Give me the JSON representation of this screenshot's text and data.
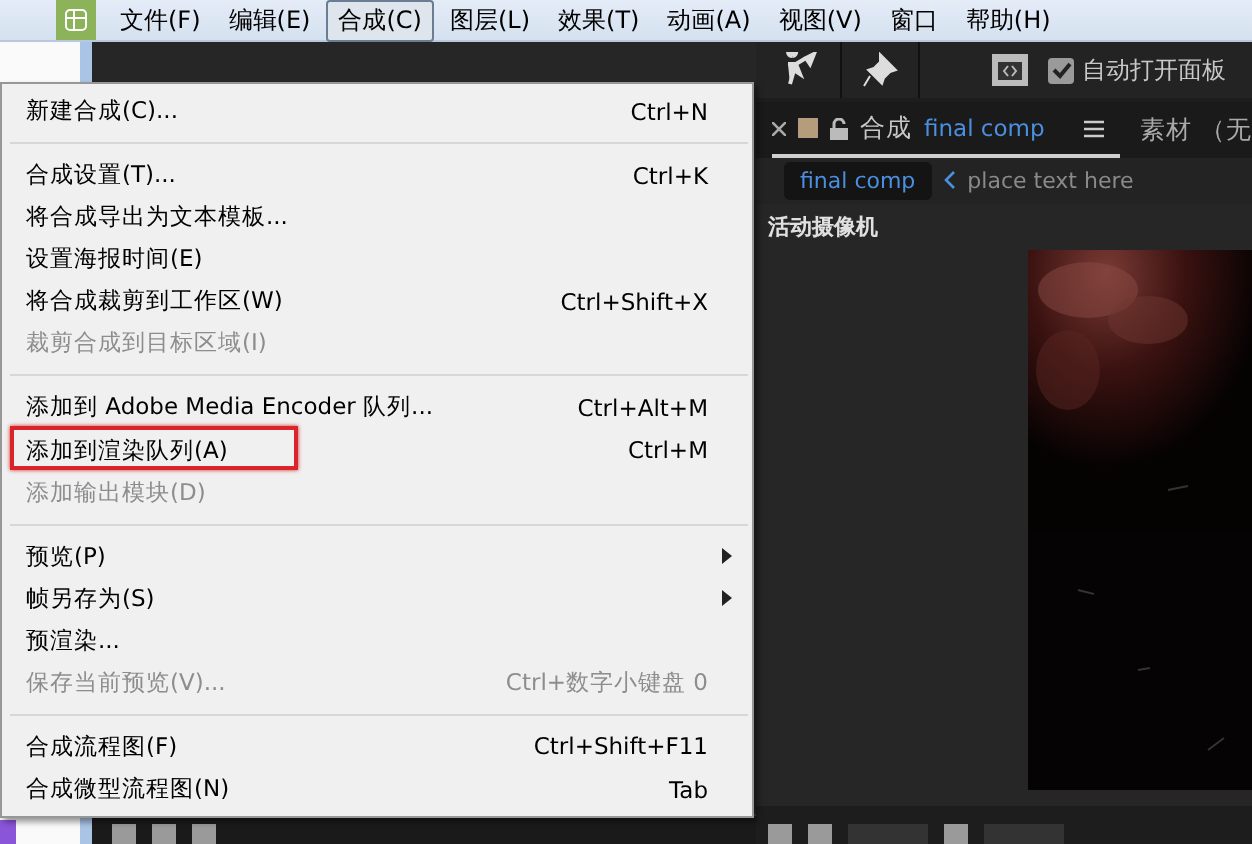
{
  "menubar": [
    {
      "label": "文件(F)",
      "selected": false
    },
    {
      "label": "编辑(E)",
      "selected": false
    },
    {
      "label": "合成(C)",
      "selected": true
    },
    {
      "label": "图层(L)",
      "selected": false
    },
    {
      "label": "效果(T)",
      "selected": false
    },
    {
      "label": "动画(A)",
      "selected": false
    },
    {
      "label": "视图(V)",
      "selected": false
    },
    {
      "label": "窗口",
      "selected": false
    },
    {
      "label": "帮助(H)",
      "selected": false
    }
  ],
  "menu": {
    "items": [
      {
        "kind": "item",
        "label": "新建合成(C)...",
        "shortcut": "Ctrl+N",
        "disabled": false,
        "submenu": false,
        "highlighted": false
      },
      {
        "kind": "separator"
      },
      {
        "kind": "item",
        "label": "合成设置(T)...",
        "shortcut": "Ctrl+K",
        "disabled": false,
        "submenu": false,
        "highlighted": false
      },
      {
        "kind": "item",
        "label": "将合成导出为文本模板...",
        "disabled": false,
        "submenu": false,
        "highlighted": false
      },
      {
        "kind": "item",
        "label": "设置海报时间(E)",
        "disabled": false,
        "submenu": false,
        "highlighted": false
      },
      {
        "kind": "item",
        "label": "将合成裁剪到工作区(W)",
        "shortcut": "Ctrl+Shift+X",
        "disabled": false,
        "submenu": false,
        "highlighted": false
      },
      {
        "kind": "item",
        "label": "裁剪合成到目标区域(I)",
        "disabled": true,
        "submenu": false,
        "highlighted": false
      },
      {
        "kind": "separator"
      },
      {
        "kind": "item",
        "label": "添加到 Adobe Media Encoder 队列...",
        "shortcut": "Ctrl+Alt+M",
        "disabled": false,
        "submenu": false,
        "highlighted": false
      },
      {
        "kind": "item",
        "label": "添加到渲染队列(A)",
        "shortcut": "Ctrl+M",
        "disabled": false,
        "submenu": false,
        "highlighted": true
      },
      {
        "kind": "item",
        "label": "添加输出模块(D)",
        "disabled": true,
        "submenu": false,
        "highlighted": false
      },
      {
        "kind": "separator"
      },
      {
        "kind": "item",
        "label": "预览(P)",
        "disabled": false,
        "submenu": true,
        "highlighted": false
      },
      {
        "kind": "item",
        "label": "帧另存为(S)",
        "disabled": false,
        "submenu": true,
        "highlighted": false
      },
      {
        "kind": "item",
        "label": "预渲染...",
        "disabled": false,
        "submenu": false,
        "highlighted": false
      },
      {
        "kind": "item",
        "label": "保存当前预览(V)...",
        "shortcut": "Ctrl+数字小键盘 0",
        "disabled": true,
        "submenu": false,
        "highlighted": false
      },
      {
        "kind": "separator"
      },
      {
        "kind": "item",
        "label": "合成流程图(F)",
        "shortcut": "Ctrl+Shift+F11",
        "disabled": false,
        "submenu": false,
        "highlighted": false
      },
      {
        "kind": "item",
        "label": "合成微型流程图(N)",
        "shortcut": "Tab",
        "disabled": false,
        "submenu": false,
        "highlighted": false
      }
    ]
  },
  "toolbar": {
    "auto_open_label": "自动打开面板",
    "auto_open_checked": true
  },
  "comp_tab": {
    "prefix": "合成",
    "name": "final comp",
    "other_tab": "素材 （无"
  },
  "breadcrumb": {
    "item": "final comp",
    "placeholder": "place text here"
  },
  "viewer": {
    "label": "活动摄像机"
  }
}
